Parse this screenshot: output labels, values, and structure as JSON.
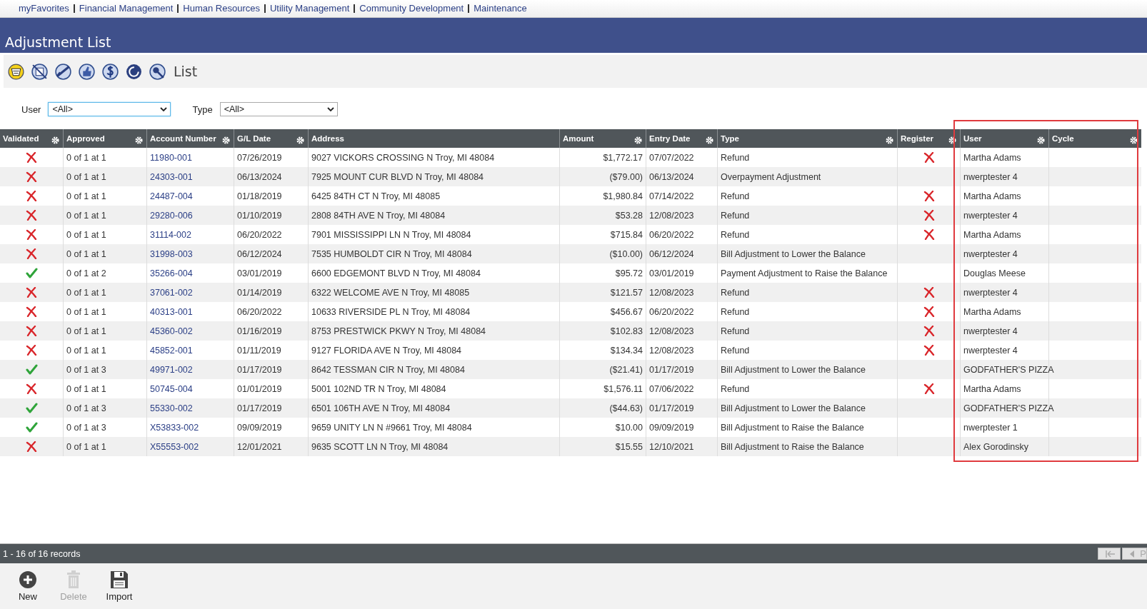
{
  "nav": [
    "myFavorites",
    "Financial Management",
    "Human Resources",
    "Utility Management",
    "Community Development",
    "Maintenance"
  ],
  "page_title": "Adjustment List",
  "toolbar": {
    "label": "List"
  },
  "filters": [
    {
      "label": "User",
      "value": "<All>",
      "focused": true
    },
    {
      "label": "Type",
      "value": "<All>",
      "focused": false
    }
  ],
  "table": {
    "columns": [
      "Validated",
      "Approved",
      "Account Number",
      "G/L Date",
      "Address",
      "Amount",
      "Entry Date",
      "Type",
      "Register",
      "User",
      "Cycle"
    ],
    "rows": [
      {
        "validated": false,
        "approved": "0 of 1 at 1",
        "account": "11980-001",
        "gl_date": "07/26/2019",
        "address": "9027 VICKORS CROSSING N Troy, MI 48084",
        "amount": "$1,772.17",
        "entry_date": "07/07/2022",
        "type": "Refund",
        "register": true,
        "user": "Martha Adams"
      },
      {
        "validated": false,
        "approved": "0 of 1 at 1",
        "account": "24303-001",
        "gl_date": "06/13/2024",
        "address": "7925 MOUNT CUR BLVD N Troy, MI 48084",
        "amount": "($79.00)",
        "entry_date": "06/13/2024",
        "type": "Overpayment Adjustment",
        "register": false,
        "user": "nwerptester 4"
      },
      {
        "validated": false,
        "approved": "0 of 1 at 1",
        "account": "24487-004",
        "gl_date": "01/18/2019",
        "address": "6425 84TH CT N Troy, MI 48085",
        "amount": "$1,980.84",
        "entry_date": "07/14/2022",
        "type": "Refund",
        "register": true,
        "user": "Martha Adams"
      },
      {
        "validated": false,
        "approved": "0 of 1 at 1",
        "account": "29280-006",
        "gl_date": "01/10/2019",
        "address": "2808 84TH AVE N Troy, MI 48084",
        "amount": "$53.28",
        "entry_date": "12/08/2023",
        "type": "Refund",
        "register": true,
        "user": "nwerptester 4"
      },
      {
        "validated": false,
        "approved": "0 of 1 at 1",
        "account": "31114-002",
        "gl_date": "06/20/2022",
        "address": "7901 MISSISSIPPI LN N Troy, MI 48084",
        "amount": "$715.84",
        "entry_date": "06/20/2022",
        "type": "Refund",
        "register": true,
        "user": "Martha Adams"
      },
      {
        "validated": false,
        "approved": "0 of 1 at 1",
        "account": "31998-003",
        "gl_date": "06/12/2024",
        "address": "7535 HUMBOLDT CIR N Troy, MI 48084",
        "amount": "($10.00)",
        "entry_date": "06/12/2024",
        "type": "Bill Adjustment to Lower the Balance",
        "register": false,
        "user": "nwerptester 4"
      },
      {
        "validated": true,
        "approved": "0 of 1 at 2",
        "account": "35266-004",
        "gl_date": "03/01/2019",
        "address": "6600 EDGEMONT BLVD N Troy, MI 48084",
        "amount": "$95.72",
        "entry_date": "03/01/2019",
        "type": "Payment Adjustment to Raise the Balance",
        "register": false,
        "user": "Douglas Meese"
      },
      {
        "validated": false,
        "approved": "0 of 1 at 1",
        "account": "37061-002",
        "gl_date": "01/14/2019",
        "address": "6322 WELCOME AVE N Troy, MI 48085",
        "amount": "$121.57",
        "entry_date": "12/08/2023",
        "type": "Refund",
        "register": true,
        "user": "nwerptester 4"
      },
      {
        "validated": false,
        "approved": "0 of 1 at 1",
        "account": "40313-001",
        "gl_date": "06/20/2022",
        "address": "10633 RIVERSIDE PL N Troy, MI 48084",
        "amount": "$456.67",
        "entry_date": "06/20/2022",
        "type": "Refund",
        "register": true,
        "user": "Martha Adams"
      },
      {
        "validated": false,
        "approved": "0 of 1 at 1",
        "account": "45360-002",
        "gl_date": "01/16/2019",
        "address": "8753 PRESTWICK PKWY N Troy, MI 48084",
        "amount": "$102.83",
        "entry_date": "12/08/2023",
        "type": "Refund",
        "register": true,
        "user": "nwerptester 4"
      },
      {
        "validated": false,
        "approved": "0 of 1 at 1",
        "account": "45852-001",
        "gl_date": "01/11/2019",
        "address": "9127 FLORIDA AVE N Troy, MI 48084",
        "amount": "$134.34",
        "entry_date": "12/08/2023",
        "type": "Refund",
        "register": true,
        "user": "nwerptester 4"
      },
      {
        "validated": true,
        "approved": "0 of 1 at 3",
        "account": "49971-002",
        "gl_date": "01/17/2019",
        "address": "8642 TESSMAN CIR N Troy, MI 48084",
        "amount": "($21.41)",
        "entry_date": "01/17/2019",
        "type": "Bill Adjustment to Lower the Balance",
        "register": false,
        "user": "GODFATHER'S PIZZA"
      },
      {
        "validated": false,
        "approved": "0 of 1 at 1",
        "account": "50745-004",
        "gl_date": "01/01/2019",
        "address": "5001 102ND TR N Troy, MI 48084",
        "amount": "$1,576.11",
        "entry_date": "07/06/2022",
        "type": "Refund",
        "register": true,
        "user": "Martha Adams"
      },
      {
        "validated": true,
        "approved": "0 of 1 at 3",
        "account": "55330-002",
        "gl_date": "01/17/2019",
        "address": "6501 106TH AVE N Troy, MI 48084",
        "amount": "($44.63)",
        "entry_date": "01/17/2019",
        "type": "Bill Adjustment to Lower the Balance",
        "register": false,
        "user": "GODFATHER'S PIZZA"
      },
      {
        "validated": true,
        "approved": "0 of 1 at 3",
        "account": "X53833-002",
        "gl_date": "09/09/2019",
        "address": "9659 UNITY LN N #9661 Troy, MI 48084",
        "amount": "$10.00",
        "entry_date": "09/09/2019",
        "type": "Bill Adjustment to Raise the Balance",
        "register": false,
        "user": "nwerptester 1"
      },
      {
        "validated": false,
        "approved": "0 of 1 at 1",
        "account": "X55553-002",
        "gl_date": "12/01/2021",
        "address": "9635 SCOTT LN N Troy, MI 48084",
        "amount": "$15.55",
        "entry_date": "12/10/2021",
        "type": "Bill Adjustment to Raise the Balance",
        "register": false,
        "user": "Alex Gorodinsky"
      }
    ]
  },
  "footer": {
    "records": "1 - 16 of 16 records",
    "prev_label": "P"
  },
  "actions": [
    {
      "kind": "new",
      "label": "New",
      "disabled": false
    },
    {
      "kind": "delete",
      "label": "Delete",
      "disabled": true
    },
    {
      "kind": "import",
      "label": "Import",
      "disabled": false
    }
  ]
}
